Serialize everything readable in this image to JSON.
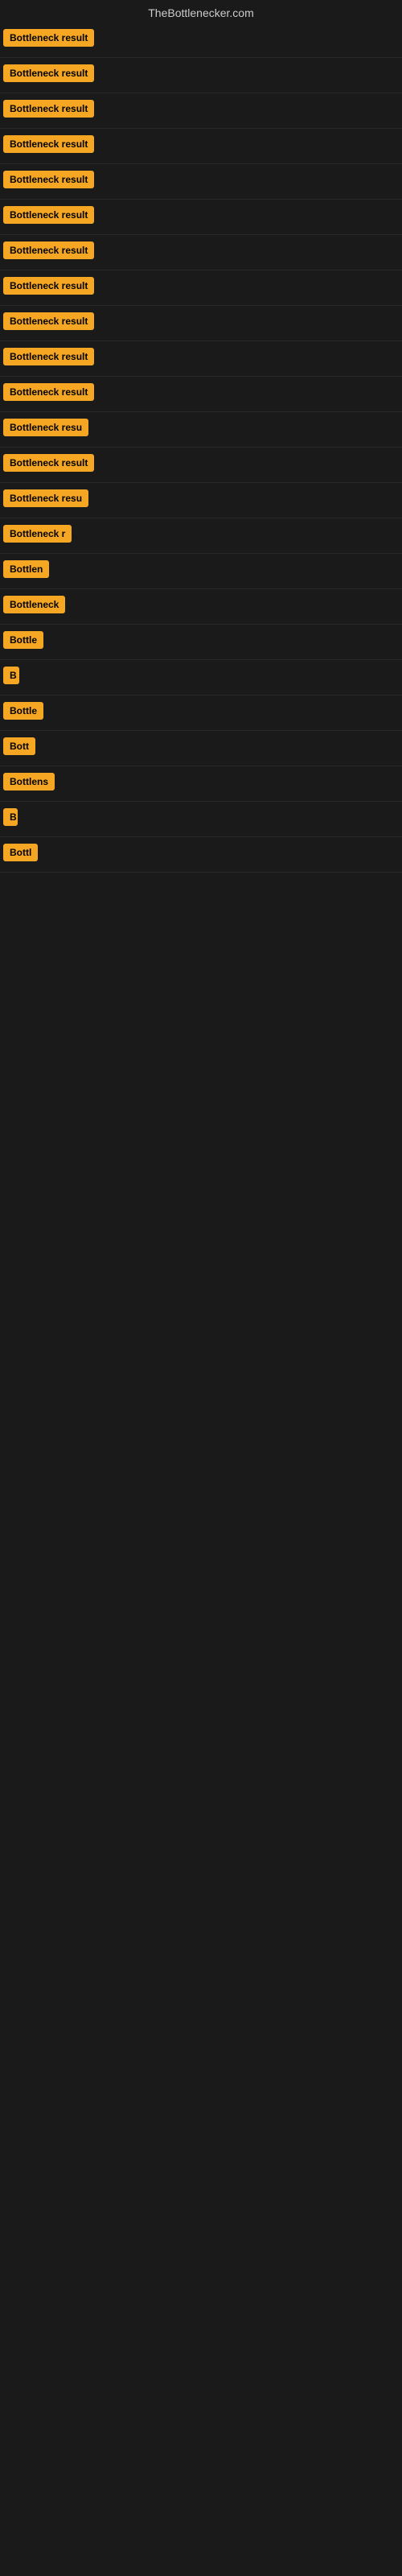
{
  "site": {
    "title": "TheBottlenecker.com"
  },
  "header": {
    "label": "Bottleneck result"
  },
  "rows": [
    {
      "id": 1,
      "label": "Bottleneck result",
      "width": 160
    },
    {
      "id": 2,
      "label": "Bottleneck result",
      "width": 160
    },
    {
      "id": 3,
      "label": "Bottleneck result",
      "width": 160
    },
    {
      "id": 4,
      "label": "Bottleneck result",
      "width": 160
    },
    {
      "id": 5,
      "label": "Bottleneck result",
      "width": 160
    },
    {
      "id": 6,
      "label": "Bottleneck result",
      "width": 160
    },
    {
      "id": 7,
      "label": "Bottleneck result",
      "width": 160
    },
    {
      "id": 8,
      "label": "Bottleneck result",
      "width": 160
    },
    {
      "id": 9,
      "label": "Bottleneck result",
      "width": 160
    },
    {
      "id": 10,
      "label": "Bottleneck result",
      "width": 160
    },
    {
      "id": 11,
      "label": "Bottleneck result",
      "width": 160
    },
    {
      "id": 12,
      "label": "Bottleneck resu",
      "width": 140
    },
    {
      "id": 13,
      "label": "Bottleneck result",
      "width": 160
    },
    {
      "id": 14,
      "label": "Bottleneck resu",
      "width": 140
    },
    {
      "id": 15,
      "label": "Bottleneck r",
      "width": 110
    },
    {
      "id": 16,
      "label": "Bottlen",
      "width": 70
    },
    {
      "id": 17,
      "label": "Bottleneck",
      "width": 90
    },
    {
      "id": 18,
      "label": "Bottle",
      "width": 60
    },
    {
      "id": 19,
      "label": "B",
      "width": 20
    },
    {
      "id": 20,
      "label": "Bottle",
      "width": 60
    },
    {
      "id": 21,
      "label": "Bott",
      "width": 45
    },
    {
      "id": 22,
      "label": "Bottlens",
      "width": 75
    },
    {
      "id": 23,
      "label": "B",
      "width": 18
    },
    {
      "id": 24,
      "label": "Bottl",
      "width": 52
    }
  ]
}
